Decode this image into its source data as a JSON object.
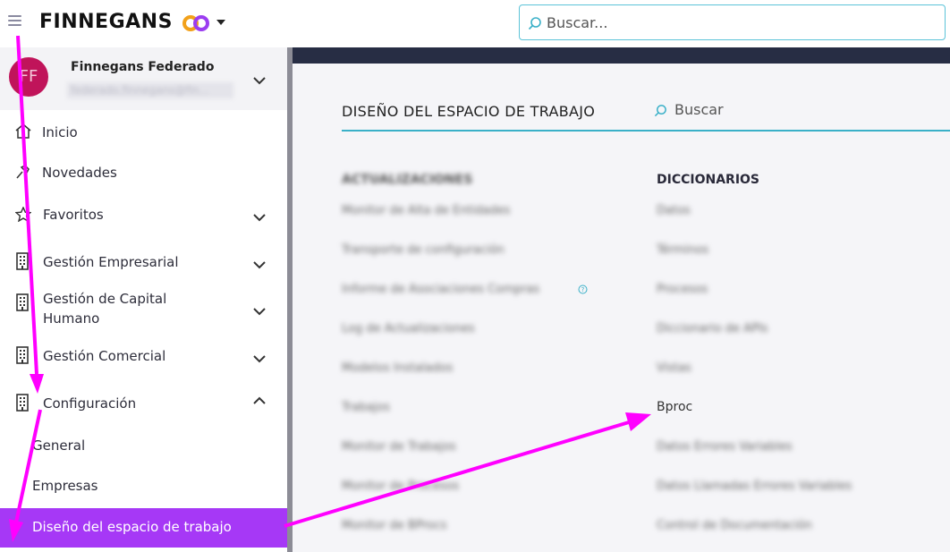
{
  "header": {
    "brand": "FINNEGANS",
    "search_placeholder": "Buscar..."
  },
  "user": {
    "initials": "FF",
    "name": "Finnegans Federado",
    "email": "federado.finnegans@fin..."
  },
  "sidebar": {
    "items": [
      {
        "label": "Inicio",
        "icon": "home-icon"
      },
      {
        "label": "Novedades",
        "icon": "pin-icon"
      },
      {
        "label": "Favoritos",
        "icon": "star-icon"
      },
      {
        "label": "Gestión Empresarial",
        "icon": "building-icon"
      },
      {
        "label": "Gestión de Capital Humano",
        "icon": "building-icon"
      },
      {
        "label": "Gestión Comercial",
        "icon": "building-icon"
      },
      {
        "label": "Configuración",
        "icon": "building-icon"
      }
    ],
    "subitems": [
      {
        "label": "General"
      },
      {
        "label": "Empresas"
      },
      {
        "label": "Diseño del espacio de trabajo"
      }
    ]
  },
  "main": {
    "title": "DISEÑO DEL ESPACIO DE TRABAJO",
    "search_placeholder": "Buscar",
    "columns": [
      {
        "heading": "ACTUALIZACIONES",
        "items": [
          "Monitor de Alta de Entidades",
          "Transporte de configuración",
          "Informe de Asociaciones Compras",
          "Log de Actualizaciones",
          "Modelos Instalados",
          "Trabajos",
          "Monitor de Trabajos",
          "Monitor de Procesos",
          "Monitor de BProcs"
        ]
      },
      {
        "heading": "DICCIONARIOS",
        "items": [
          "Datos",
          "Términos",
          "Procesos",
          "Diccionario de APIs",
          "Vistas",
          "Bproc",
          "Datos Errores Variables",
          "Datos Llamadas Errores Variables",
          "Control de Documentación"
        ]
      }
    ]
  },
  "colors": {
    "accent": "#a638f6",
    "avatar": "#c0145a",
    "band": "#272d44",
    "line": "#3ab0c8",
    "arrow": "#ff00ff"
  }
}
